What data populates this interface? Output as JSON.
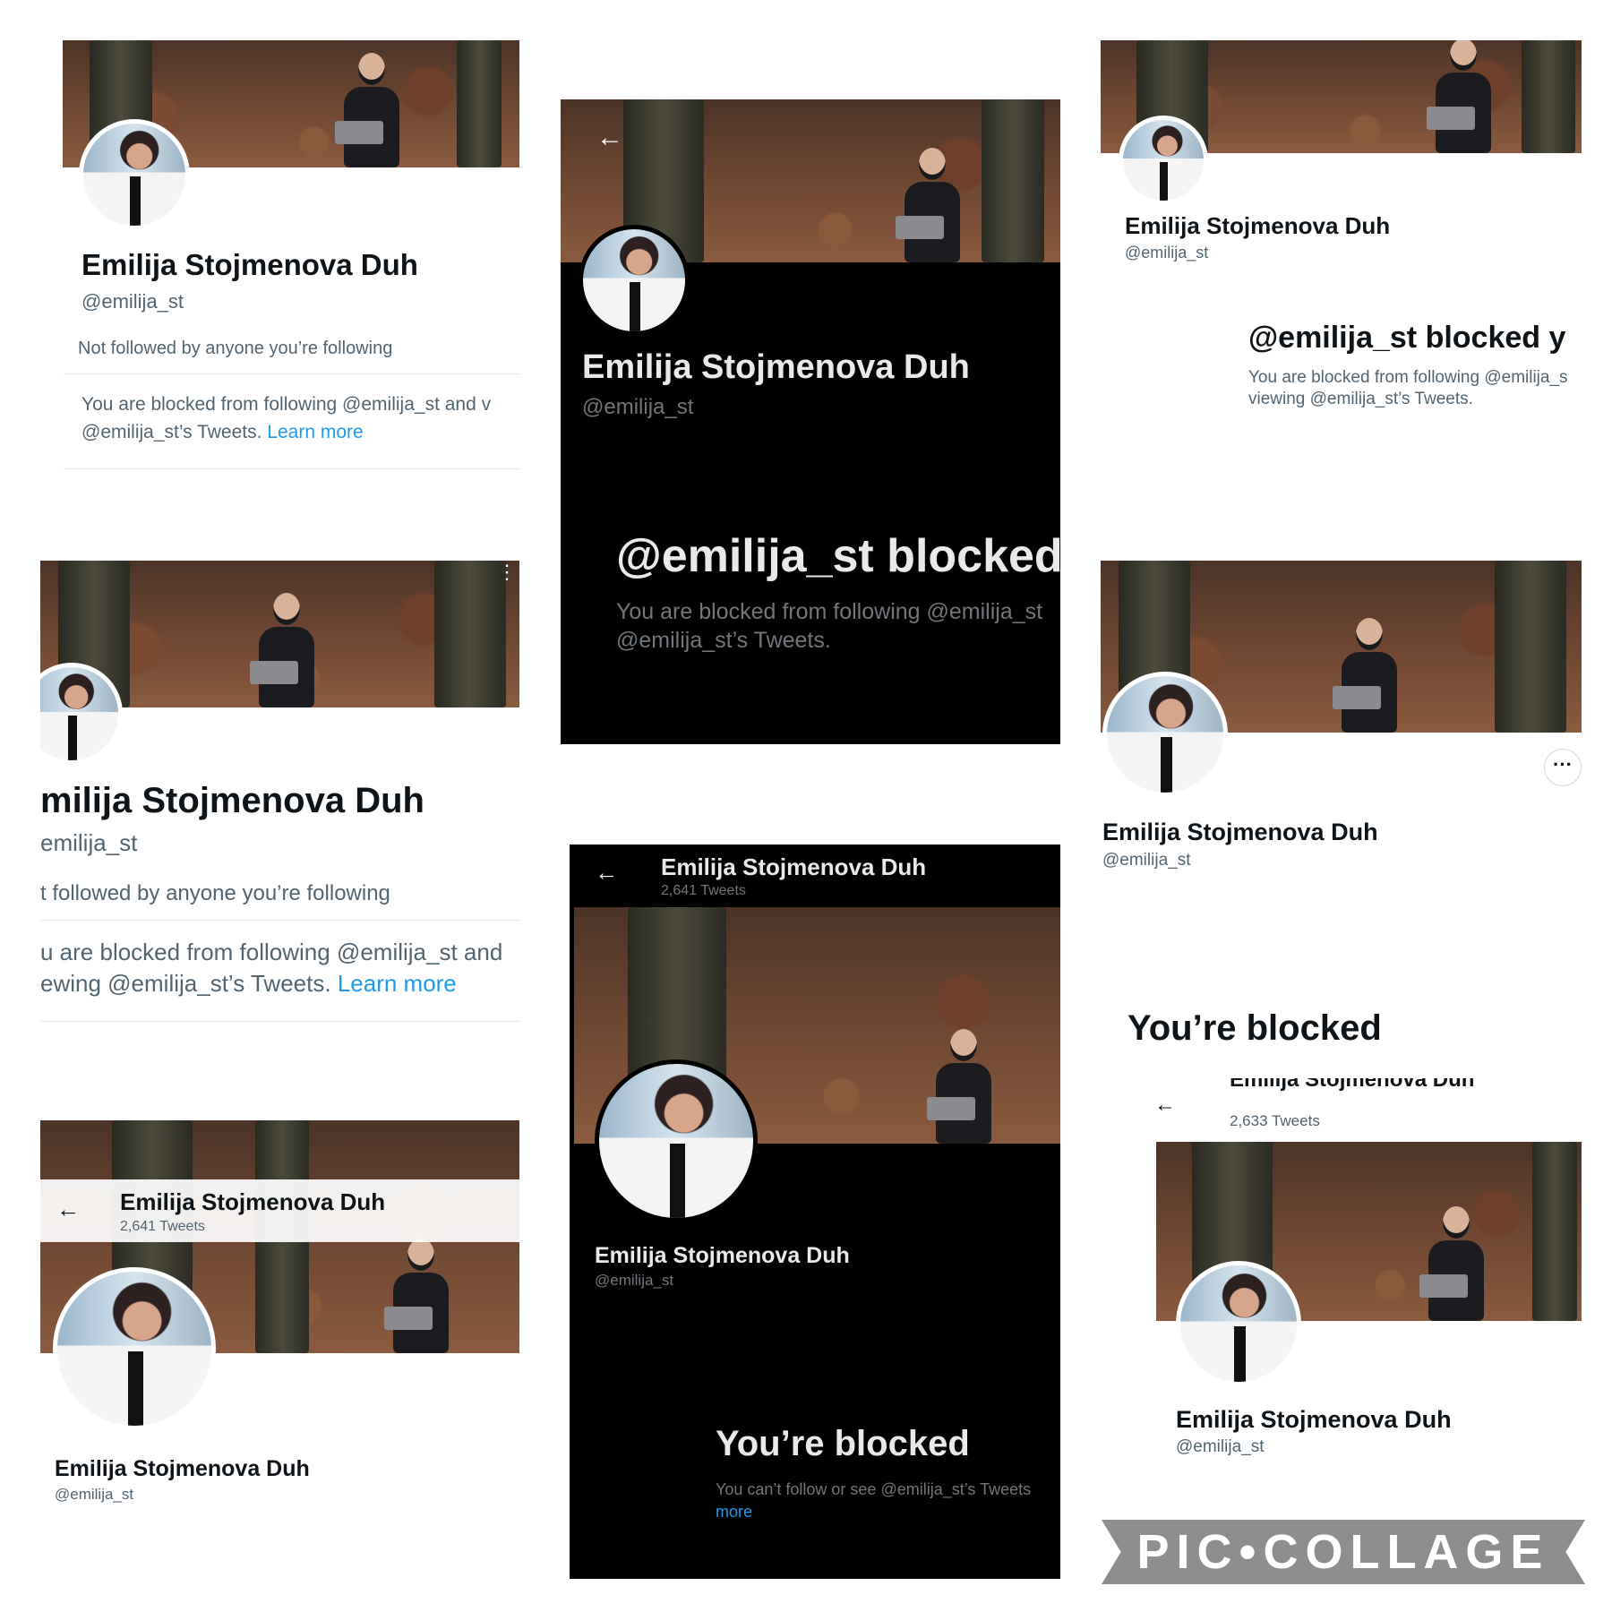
{
  "profile": {
    "name": "Emilija Stojmenova Duh",
    "handle": "@emilija_st",
    "not_followed": "Not followed by anyone you’re following"
  },
  "p1": {
    "blocked_line1": "You are blocked from following @emilija_st and v",
    "blocked_line2": "@emilija_st’s Tweets.",
    "learn_more": "Learn more"
  },
  "p2": {
    "back": "←",
    "blocked_title": "@emilija_st blocked",
    "blocked_line1": "You are blocked from following @emilija_st",
    "blocked_line2": "@emilija_st’s Tweets."
  },
  "p3": {
    "blocked_title": "@emilija_st blocked y",
    "blocked_line1": "You are blocked from following @emilija_s",
    "blocked_line2": "viewing @emilija_st’s Tweets."
  },
  "p4": {
    "name": "milija Stojmenova Duh",
    "handle": "emilija_st",
    "not_followed": "t followed by anyone you’re following",
    "blocked_line1": "u are blocked from following @emilija_st and",
    "blocked_line2": "ewing @emilija_st’s Tweets.",
    "learn_more": "Learn more"
  },
  "p5": {
    "more": "···"
  },
  "p6": {
    "back": "←",
    "tweets": "2,641 Tweets"
  },
  "p7": {
    "back": "←",
    "tweets": "2,641 Tweets",
    "blocked_title": "You’re blocked",
    "blocked_line1": "You can’t follow or see @emilija_st’s Tweets",
    "more": "more"
  },
  "p8": {
    "blocked_title": "You’re blocked",
    "back": "←",
    "header_name": "Emilija Stojmenova Duh",
    "tweets": "2,633 Tweets"
  },
  "watermark": "PIC•COLLAGE",
  "colors": {
    "link": "#1d9bf0",
    "dark_bg": "#000000",
    "muted": "#536471"
  }
}
